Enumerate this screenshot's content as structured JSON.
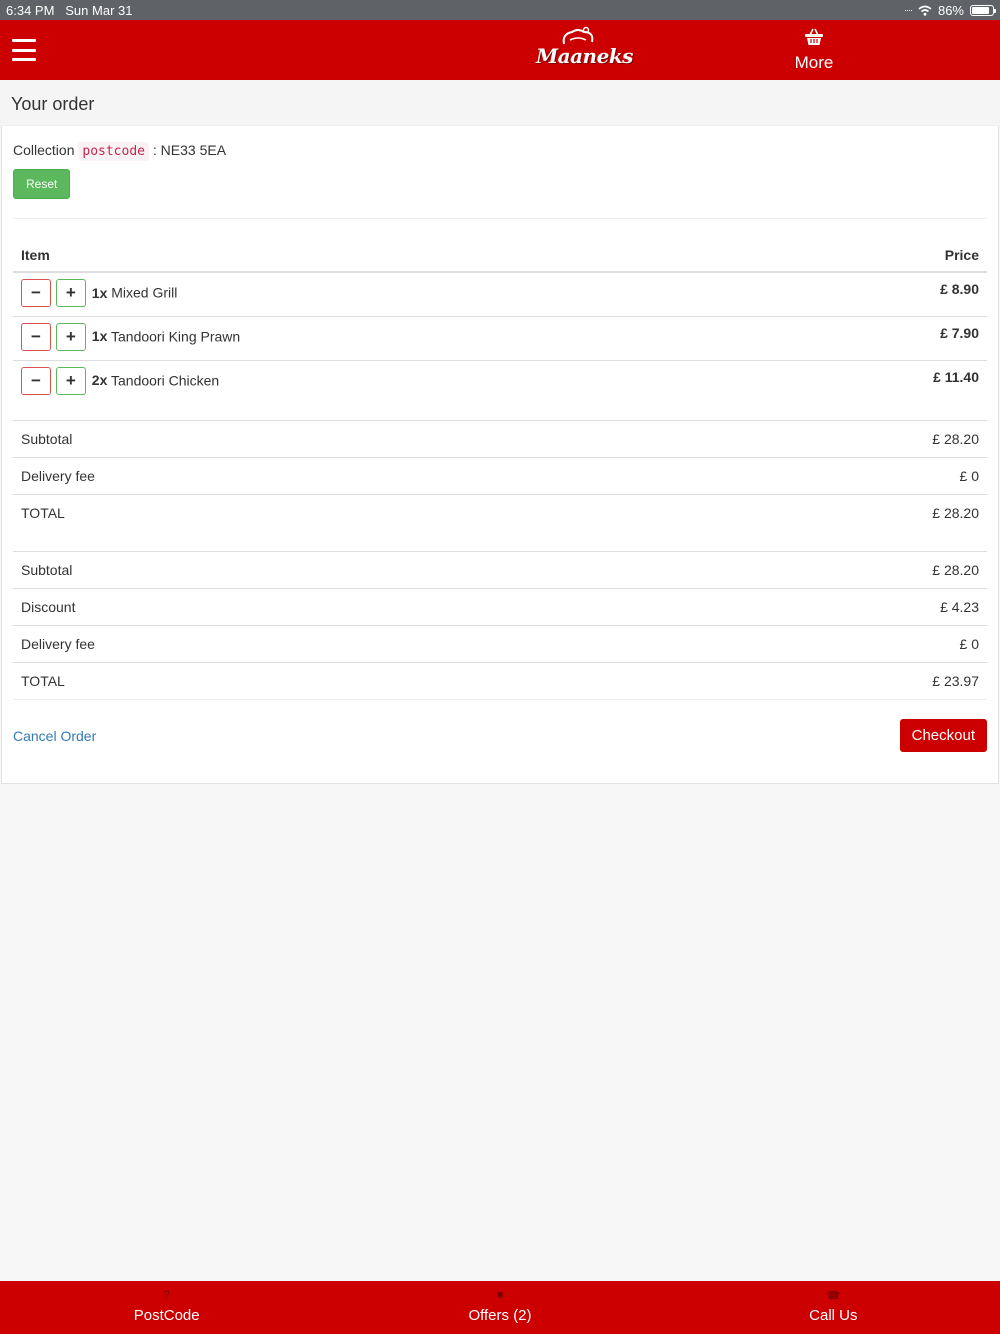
{
  "status_bar": {
    "time": "6:34 PM",
    "date": "Sun Mar 31",
    "battery": "86%",
    "battery_level": 0.86
  },
  "navbar": {
    "logo_text": "Maaneks",
    "more_label": "More"
  },
  "page": {
    "title": "Your order"
  },
  "collection": {
    "label": "Collection",
    "code": "postcode",
    "separator": ": NE33 5EA",
    "reset_label": "Reset"
  },
  "items_table": {
    "headers": {
      "item": "Item",
      "price": "Price"
    },
    "rows": [
      {
        "qty": "1x",
        "name": "Mixed Grill",
        "price": "£ 8.90"
      },
      {
        "qty": "1x",
        "name": "Tandoori King Prawn",
        "price": "£ 7.90"
      },
      {
        "qty": "2x",
        "name": "Tandoori Chicken",
        "price": "£ 11.40"
      }
    ]
  },
  "totals": [
    {
      "label": "Subtotal",
      "value": "£ 28.20"
    },
    {
      "label": "Delivery fee",
      "value": "£ 0"
    },
    {
      "label": "TOTAL",
      "value": "£ 28.20"
    }
  ],
  "totals_discounted": [
    {
      "label": "Subtotal",
      "value": "£ 28.20"
    },
    {
      "label": "Discount",
      "value": "£ 4.23"
    },
    {
      "label": "Delivery fee",
      "value": "£ 0"
    },
    {
      "label": "TOTAL",
      "value": "£ 23.97"
    }
  ],
  "actions": {
    "cancel_label": "Cancel Order",
    "checkout_label": "Checkout"
  },
  "bottom_bar": [
    {
      "icon": "question-icon",
      "label": "PostCode"
    },
    {
      "icon": "gift-icon",
      "label": "Offers (2)"
    },
    {
      "icon": "phone-icon",
      "label": "Call Us"
    }
  ],
  "colors": {
    "brand_red": "#cc0000",
    "success_green": "#5cb85c",
    "danger_red": "#d9534f",
    "link_blue": "#337ab7"
  }
}
